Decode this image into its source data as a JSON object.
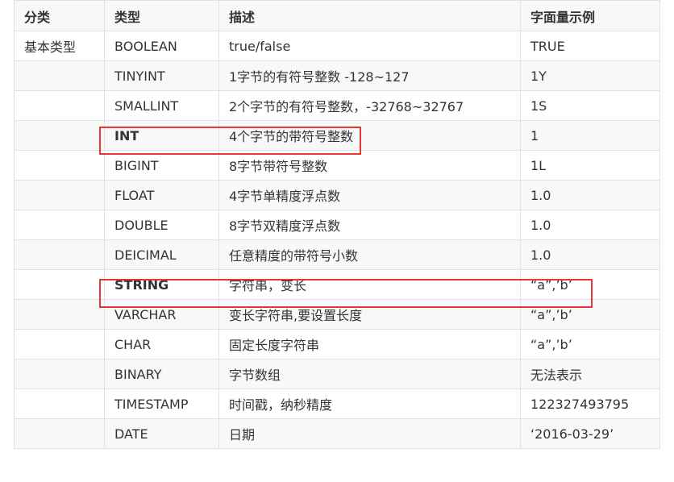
{
  "table": {
    "headers": [
      "分类",
      "类型",
      "描述",
      "字面量示例"
    ],
    "rows": [
      {
        "category": "基本类型",
        "type": "BOOLEAN",
        "desc": "true/false",
        "example": "TRUE"
      },
      {
        "category": "",
        "type": "TINYINT",
        "desc": "1字节的有符号整数 -128~127",
        "example": "1Y"
      },
      {
        "category": "",
        "type": "SMALLINT",
        "desc": "2个字节的有符号整数，-32768~32767",
        "example": "1S"
      },
      {
        "category": "",
        "type": "INT",
        "desc": "4个字节的带符号整数",
        "example": "1"
      },
      {
        "category": "",
        "type": "BIGINT",
        "desc": "8字节带符号整数",
        "example": "1L"
      },
      {
        "category": "",
        "type": "FLOAT",
        "desc": "4字节单精度浮点数",
        "example": "1.0"
      },
      {
        "category": "",
        "type": "DOUBLE",
        "desc": "8字节双精度浮点数",
        "example": "1.0"
      },
      {
        "category": "",
        "type": "DEICIMAL",
        "desc": "任意精度的带符号小数",
        "example": "1.0"
      },
      {
        "category": "",
        "type": "STRING",
        "desc": "字符串，变长",
        "example": "“a”,’b’"
      },
      {
        "category": "",
        "type": "VARCHAR",
        "desc": "变长字符串,要设置长度",
        "example": "“a”,’b’"
      },
      {
        "category": "",
        "type": "CHAR",
        "desc": "固定长度字符串",
        "example": "“a”,’b’"
      },
      {
        "category": "",
        "type": "BINARY",
        "desc": "字节数组",
        "example": "无法表示"
      },
      {
        "category": "",
        "type": "TIMESTAMP",
        "desc": "时间戳，纳秒精度",
        "example": "122327493795"
      },
      {
        "category": "",
        "type": "DATE",
        "desc": "日期",
        "example": "‘2016-03-29’"
      }
    ]
  },
  "colors": {
    "highlight": "#e53935",
    "border": "#dfe2e5",
    "header_bg": "#f6f8fa",
    "row_alt_bg": "#f8f8f8"
  }
}
